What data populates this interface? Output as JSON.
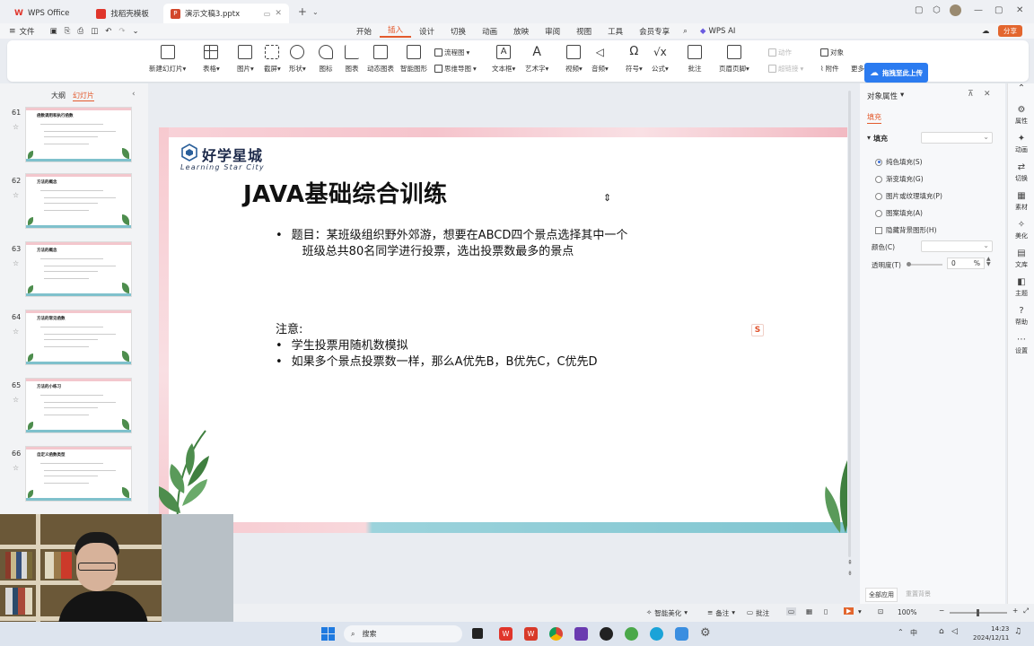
{
  "tabs": [
    {
      "label": "WPS Office",
      "color": "#e0352b"
    },
    {
      "label": "找稻壳模板",
      "color": "#e0352b"
    },
    {
      "label": "演示文稿3.pptx",
      "color": "#d2472b"
    }
  ],
  "menu": {
    "file": "文件",
    "items": [
      "开始",
      "插入",
      "设计",
      "切换",
      "动画",
      "放映",
      "审阅",
      "视图",
      "工具",
      "会员专享"
    ],
    "active": "插入",
    "wps_ai": "WPS AI",
    "share": "分享"
  },
  "ribbon": {
    "new_slide": "新建幻灯片",
    "table": "表格",
    "picture": "图片",
    "screenshot": "截屏",
    "shape": "形状",
    "icon": "图标",
    "chart": "图表",
    "dynamic_chart": "动态图表",
    "smart_graphic": "智能图形",
    "flowchart": "流程图",
    "mindmap": "思维导图",
    "textbox": "文本框",
    "wordart": "艺术字",
    "video": "视频",
    "audio": "音频",
    "symbol": "符号",
    "formula": "公式",
    "comment": "批注",
    "header_footer": "页眉页脚",
    "action": "动作",
    "hyperlink": "超链接",
    "attach": "附件",
    "object": "对象",
    "more": "更多",
    "upload": "拖拽至此上传"
  },
  "leftpanel": {
    "tab_outline": "大纲",
    "tab_slides": "幻灯片",
    "slides": [
      {
        "num": "61",
        "title": "函数调用和执行函数"
      },
      {
        "num": "62",
        "title": "方法的概念"
      },
      {
        "num": "63",
        "title": "方法的概念"
      },
      {
        "num": "64",
        "title": "方法的常见函数"
      },
      {
        "num": "65",
        "title": "方法的小练习"
      },
      {
        "num": "66",
        "title": "自定义函数类型"
      }
    ]
  },
  "slide": {
    "logo_text": "好学星城",
    "logo_sub": "Learning Star City",
    "title": "JAVA基础综合训练",
    "bullet1_line1": "题目：某班级组织野外郊游，想要在ABCD四个景点选择其中一个",
    "bullet1_line2": "班级总共80名同学进行投票，选出投票数最多的景点",
    "note_label": "注意:",
    "note1": "学生投票用随机数模拟",
    "note2": "如果多个景点投票数一样，那么A优先B，B优先C，C优先D",
    "bullet": "•"
  },
  "rightpanel": {
    "title": "对象属性",
    "tab_fill": "填充",
    "section_fill": "填充",
    "options": [
      "纯色填充(S)",
      "渐变填充(G)",
      "图片或纹理填充(P)",
      "图案填充(A)"
    ],
    "selected": 0,
    "hide_bg": "隐藏背景图形(H)",
    "color_label": "颜色(C)",
    "transparency_label": "透明度(T)",
    "transparency_value": "0",
    "transparency_unit": "%",
    "apply_all": "全部应用",
    "reset_bg": "重置背景"
  },
  "rightbar": [
    "属性",
    "动画",
    "切换",
    "素材",
    "美化",
    "文库",
    "主题",
    "帮助",
    "设置"
  ],
  "statusbar": {
    "smart_beautify": "智能美化",
    "notes": "备注",
    "comment": "批注",
    "zoom": "100%"
  },
  "taskbar": {
    "search": "搜索",
    "time": "14:23",
    "date": "2024/12/11",
    "lang": "中"
  }
}
